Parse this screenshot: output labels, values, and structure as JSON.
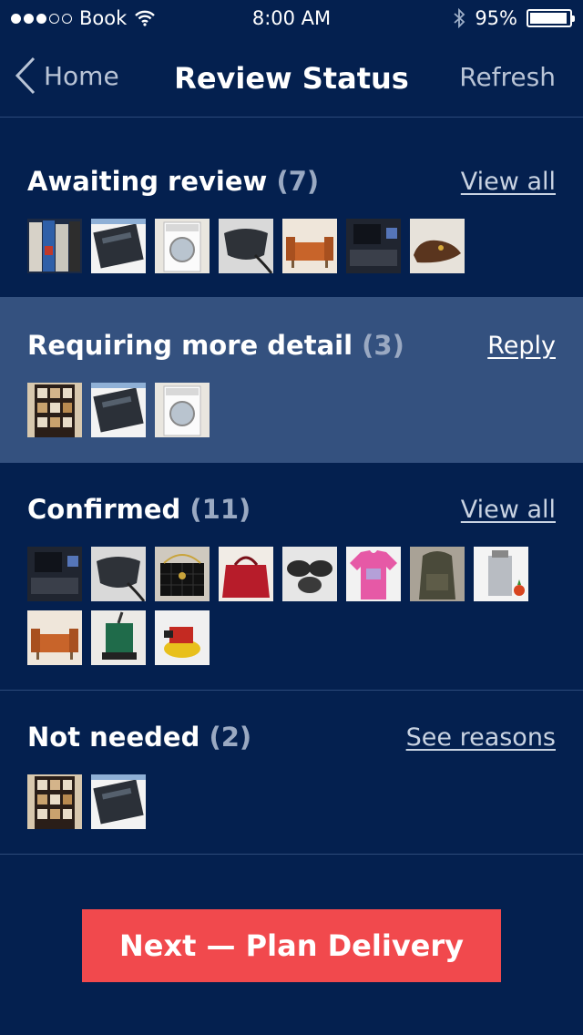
{
  "status_bar": {
    "carrier": "Book",
    "time": "8:00 AM",
    "battery": "95%",
    "signal_bars": 3,
    "signal_total": 5,
    "battery_level": 0.95
  },
  "nav": {
    "back_label": "Home",
    "title": "Review Status",
    "refresh_label": "Refresh"
  },
  "sections": [
    {
      "title": "Awaiting review",
      "count": "(7)",
      "link": "View all",
      "thumbs": [
        "books",
        "xbox",
        "washer",
        "bike-seat",
        "sofa",
        "keyboard",
        "shoes"
      ]
    },
    {
      "title": "Requiring more detail",
      "count": "(3)",
      "link": "Reply",
      "thumbs": [
        "shelf",
        "xbox",
        "washer"
      ]
    },
    {
      "title": "Confirmed",
      "count": "(11)",
      "link": "View all",
      "thumbs": [
        "keyboard",
        "bike-seat",
        "chanel-bag",
        "red-bag",
        "pucks",
        "pink-shirt",
        "backpack",
        "juicer",
        "sofa",
        "floor-scrubber",
        "polisher"
      ]
    },
    {
      "title": "Not needed",
      "count": "(2)",
      "link": "See reasons",
      "thumbs": [
        "shelf",
        "xbox"
      ]
    }
  ],
  "next_button": {
    "label": "Next — Plan Delivery"
  },
  "colors": {
    "background": "#04204f",
    "highlight": "#34517f",
    "accent": "#f1494d",
    "muted_text": "#9aa9c2"
  }
}
